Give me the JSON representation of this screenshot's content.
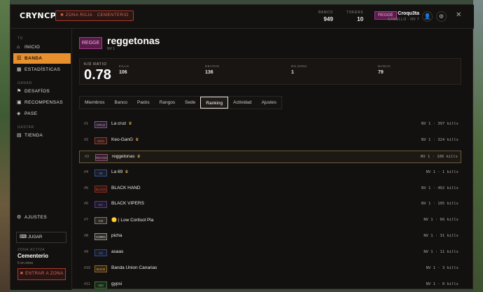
{
  "app": {
    "logo": "CRYNCPVP",
    "zone_pill": "✱ ZONA ROJA · CEMENTERIO",
    "stats": [
      {
        "label": "BANCO",
        "value": "949"
      },
      {
        "label": "TOKENS",
        "value": "10"
      }
    ],
    "user": {
      "gang_tag": "REGGE",
      "name": "Croqu3ta",
      "sub": "CAMELLO · NV 7"
    },
    "icons": [
      "user-icon",
      "gear-icon",
      "close-icon"
    ],
    "close_glyph": "✕",
    "user_glyph": "👤",
    "gear_glyph": "⚙"
  },
  "sidebar": {
    "section_tu": "TÚ",
    "items_tu": [
      {
        "label": "INICIO",
        "icon": "⌂",
        "active": false
      },
      {
        "label": "BANDA",
        "icon": "☷",
        "active": true
      },
      {
        "label": "ESTADÍSTICAS",
        "icon": "▦",
        "active": false
      }
    ],
    "section_ganar": "GANAR",
    "items_ganar": [
      {
        "label": "DESAFÍOS",
        "icon": "⚑"
      },
      {
        "label": "RECOMPENSAS",
        "icon": "▣"
      },
      {
        "label": "PASE",
        "icon": "◈"
      }
    ],
    "section_gastar": "GASTAR",
    "items_gastar": [
      {
        "label": "TIENDA",
        "icon": "▤"
      }
    ],
    "settings": {
      "label": "AJUSTES",
      "icon": "⚙"
    },
    "play": {
      "label": "JUGAR",
      "icon": "⌨"
    },
    "zone": {
      "label": "ZONA ACTIVA",
      "name": "Cementerio",
      "count": "5 en zona",
      "enter": "ENTRAR A ZONA",
      "enter_icon": "✖"
    }
  },
  "gang": {
    "tag": "REGGE",
    "name": "reggetonas",
    "level": "NV 1",
    "kd_label": "K/D RATIO",
    "kd_value": "0.78",
    "stats": [
      {
        "label": "KILLS",
        "value": "106"
      },
      {
        "label": "DEATHS",
        "value": "136"
      },
      {
        "label": "EN ZONA",
        "value": "1"
      },
      {
        "label": "BANCO",
        "value": "79"
      }
    ]
  },
  "tabs": [
    "Miembros",
    "Banco",
    "Packs",
    "Rangos",
    "Sede",
    "Ranking",
    "Actividad",
    "Ajustes"
  ],
  "active_tab": "Ranking",
  "ranking": [
    {
      "rank": "#1",
      "tag": "CRUZ",
      "tag_color": "#b88ad8",
      "name": "La cruz",
      "crown": true,
      "info": "NV 1 · 397 kills"
    },
    {
      "rank": "#2",
      "tag": "KEO",
      "tag_color": "#e0604a",
      "name": "Keo-GanG",
      "crown": true,
      "info": "NV 1 · 324 kills"
    },
    {
      "rank": "#3",
      "tag": "REGGE",
      "tag_color": "#d07ab8",
      "name": "reggetonas",
      "crown": true,
      "info": "NV 1 · 106 kills",
      "mine": true
    },
    {
      "rank": "#4",
      "tag": "69",
      "tag_color": "#4a7ad0",
      "name": "La 69",
      "crown": true,
      "info": "NV 1 · 1 kills"
    },
    {
      "rank": "#5",
      "tag": "BLACK",
      "tag_color": "#d0402a",
      "name": "BLACK HAND",
      "crown": false,
      "info": "NV 1 · 402 kills"
    },
    {
      "rank": "#6",
      "tag": "BV",
      "tag_color": "#7a5ad8",
      "name": "BLACK VIPERS",
      "crown": false,
      "info": "NV 1 · 105 kills"
    },
    {
      "rank": "#7",
      "tag": "CO",
      "tag_color": "#c8c0b0",
      "name": "🟡 | Low Cortisol Pla",
      "crown": false,
      "info": "NV 1 · 66 kills"
    },
    {
      "rank": "#8",
      "tag": "CORO",
      "tag_color": "#e8e2d8",
      "name": "picha",
      "crown": false,
      "info": "NV 1 · 31 kills"
    },
    {
      "rank": "#9",
      "tag": "SS",
      "tag_color": "#4a6ad8",
      "name": "asaas",
      "crown": false,
      "info": "NV 1 · 11 kills"
    },
    {
      "rank": "#10",
      "tag": "BUCB",
      "tag_color": "#e8a840",
      "name": "Banda Union Canarias",
      "crown": false,
      "info": "NV 1 · 3 kills"
    },
    {
      "rank": "#11",
      "tag": "968",
      "tag_color": "#5ab85a",
      "name": "gypsi",
      "crown": false,
      "info": "NV 1 · 0 kills"
    }
  ]
}
